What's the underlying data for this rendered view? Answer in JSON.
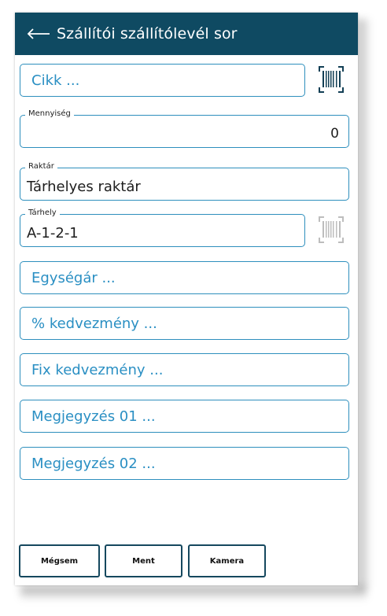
{
  "colors": {
    "header_bg": "#0f4a62",
    "accent": "#2a8fc3",
    "barcode_active": "#123f55",
    "barcode_disabled": "#bdbdbd"
  },
  "header": {
    "back_icon": "arrow-left-icon",
    "title": "Szállítói szállítólevél sor"
  },
  "form": {
    "cikk": {
      "placeholder": "Cikk ..."
    },
    "mennyiseg": {
      "label": "Mennyiség",
      "value": "0"
    },
    "raktar": {
      "label": "Raktár",
      "value": "Tárhelyes raktár"
    },
    "tarhely": {
      "label": "Tárhely",
      "value": "A-1-2-1"
    },
    "egysegar": {
      "placeholder": "Egységár ..."
    },
    "szazalek_kedvezmeny": {
      "placeholder": "% kedvezmény ..."
    },
    "fix_kedvezmeny": {
      "placeholder": "Fix kedvezmény ..."
    },
    "megjegyzes_01": {
      "placeholder": "Megjegyzés 01 ..."
    },
    "megjegyzes_02": {
      "placeholder": "Megjegyzés 02 ..."
    }
  },
  "icons": {
    "cikk_scan": "barcode-scan-icon",
    "tarhely_scan": "barcode-scan-icon-disabled"
  },
  "buttons": {
    "cancel": "Mégsem",
    "save": "Ment",
    "camera": "Kamera"
  }
}
